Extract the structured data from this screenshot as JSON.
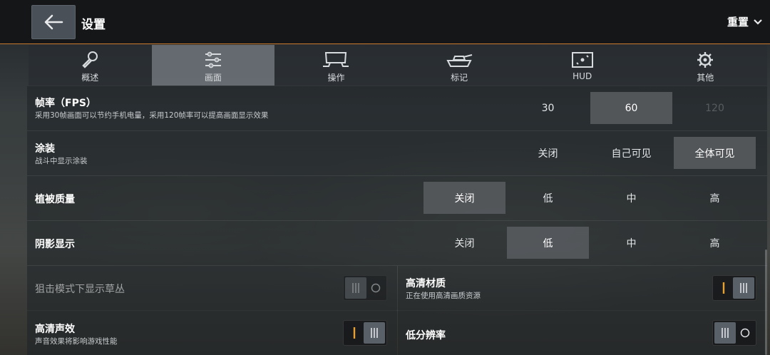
{
  "header": {
    "title": "设置",
    "reset_label": "重置"
  },
  "tabs": [
    {
      "label": "概述",
      "icon": "wrench-icon",
      "active": false
    },
    {
      "label": "画面",
      "icon": "sliders-icon",
      "active": true
    },
    {
      "label": "操作",
      "icon": "controller-icon",
      "active": false
    },
    {
      "label": "标记",
      "icon": "tank-icon",
      "active": false
    },
    {
      "label": "HUD",
      "icon": "hud-icon",
      "active": false
    },
    {
      "label": "其他",
      "icon": "gear-icon",
      "active": false
    }
  ],
  "fps": {
    "label": "帧率（FPS）",
    "desc": "采用30帧画面可以节约手机电量，采用120帧率可以提高画面显示效果",
    "options": [
      "30",
      "60",
      "120"
    ],
    "selected": "60"
  },
  "skin": {
    "label": "涂装",
    "desc": "战斗中显示涂装",
    "options": [
      "关闭",
      "自己可见",
      "全体可见"
    ],
    "selected": "全体可见"
  },
  "vegetation": {
    "label": "植被质量",
    "options": [
      "关闭",
      "低",
      "中",
      "高"
    ],
    "selected": "关闭"
  },
  "shadow": {
    "label": "阴影显示",
    "options": [
      "关闭",
      "低",
      "中",
      "高"
    ],
    "selected": "低"
  },
  "sniper_grass": {
    "label": "狙击模式下显示草丛",
    "on": false
  },
  "hd_texture": {
    "label": "高清材质",
    "desc": "正在使用高清画质资源",
    "on": true
  },
  "hd_sound": {
    "label": "高清声效",
    "desc": "声音效果将影响游戏性能",
    "on": true
  },
  "low_res": {
    "label": "低分辨率",
    "on": false
  },
  "colors": {
    "accent": "#c77a2e",
    "toggle_on_mark": "#e8a030"
  }
}
